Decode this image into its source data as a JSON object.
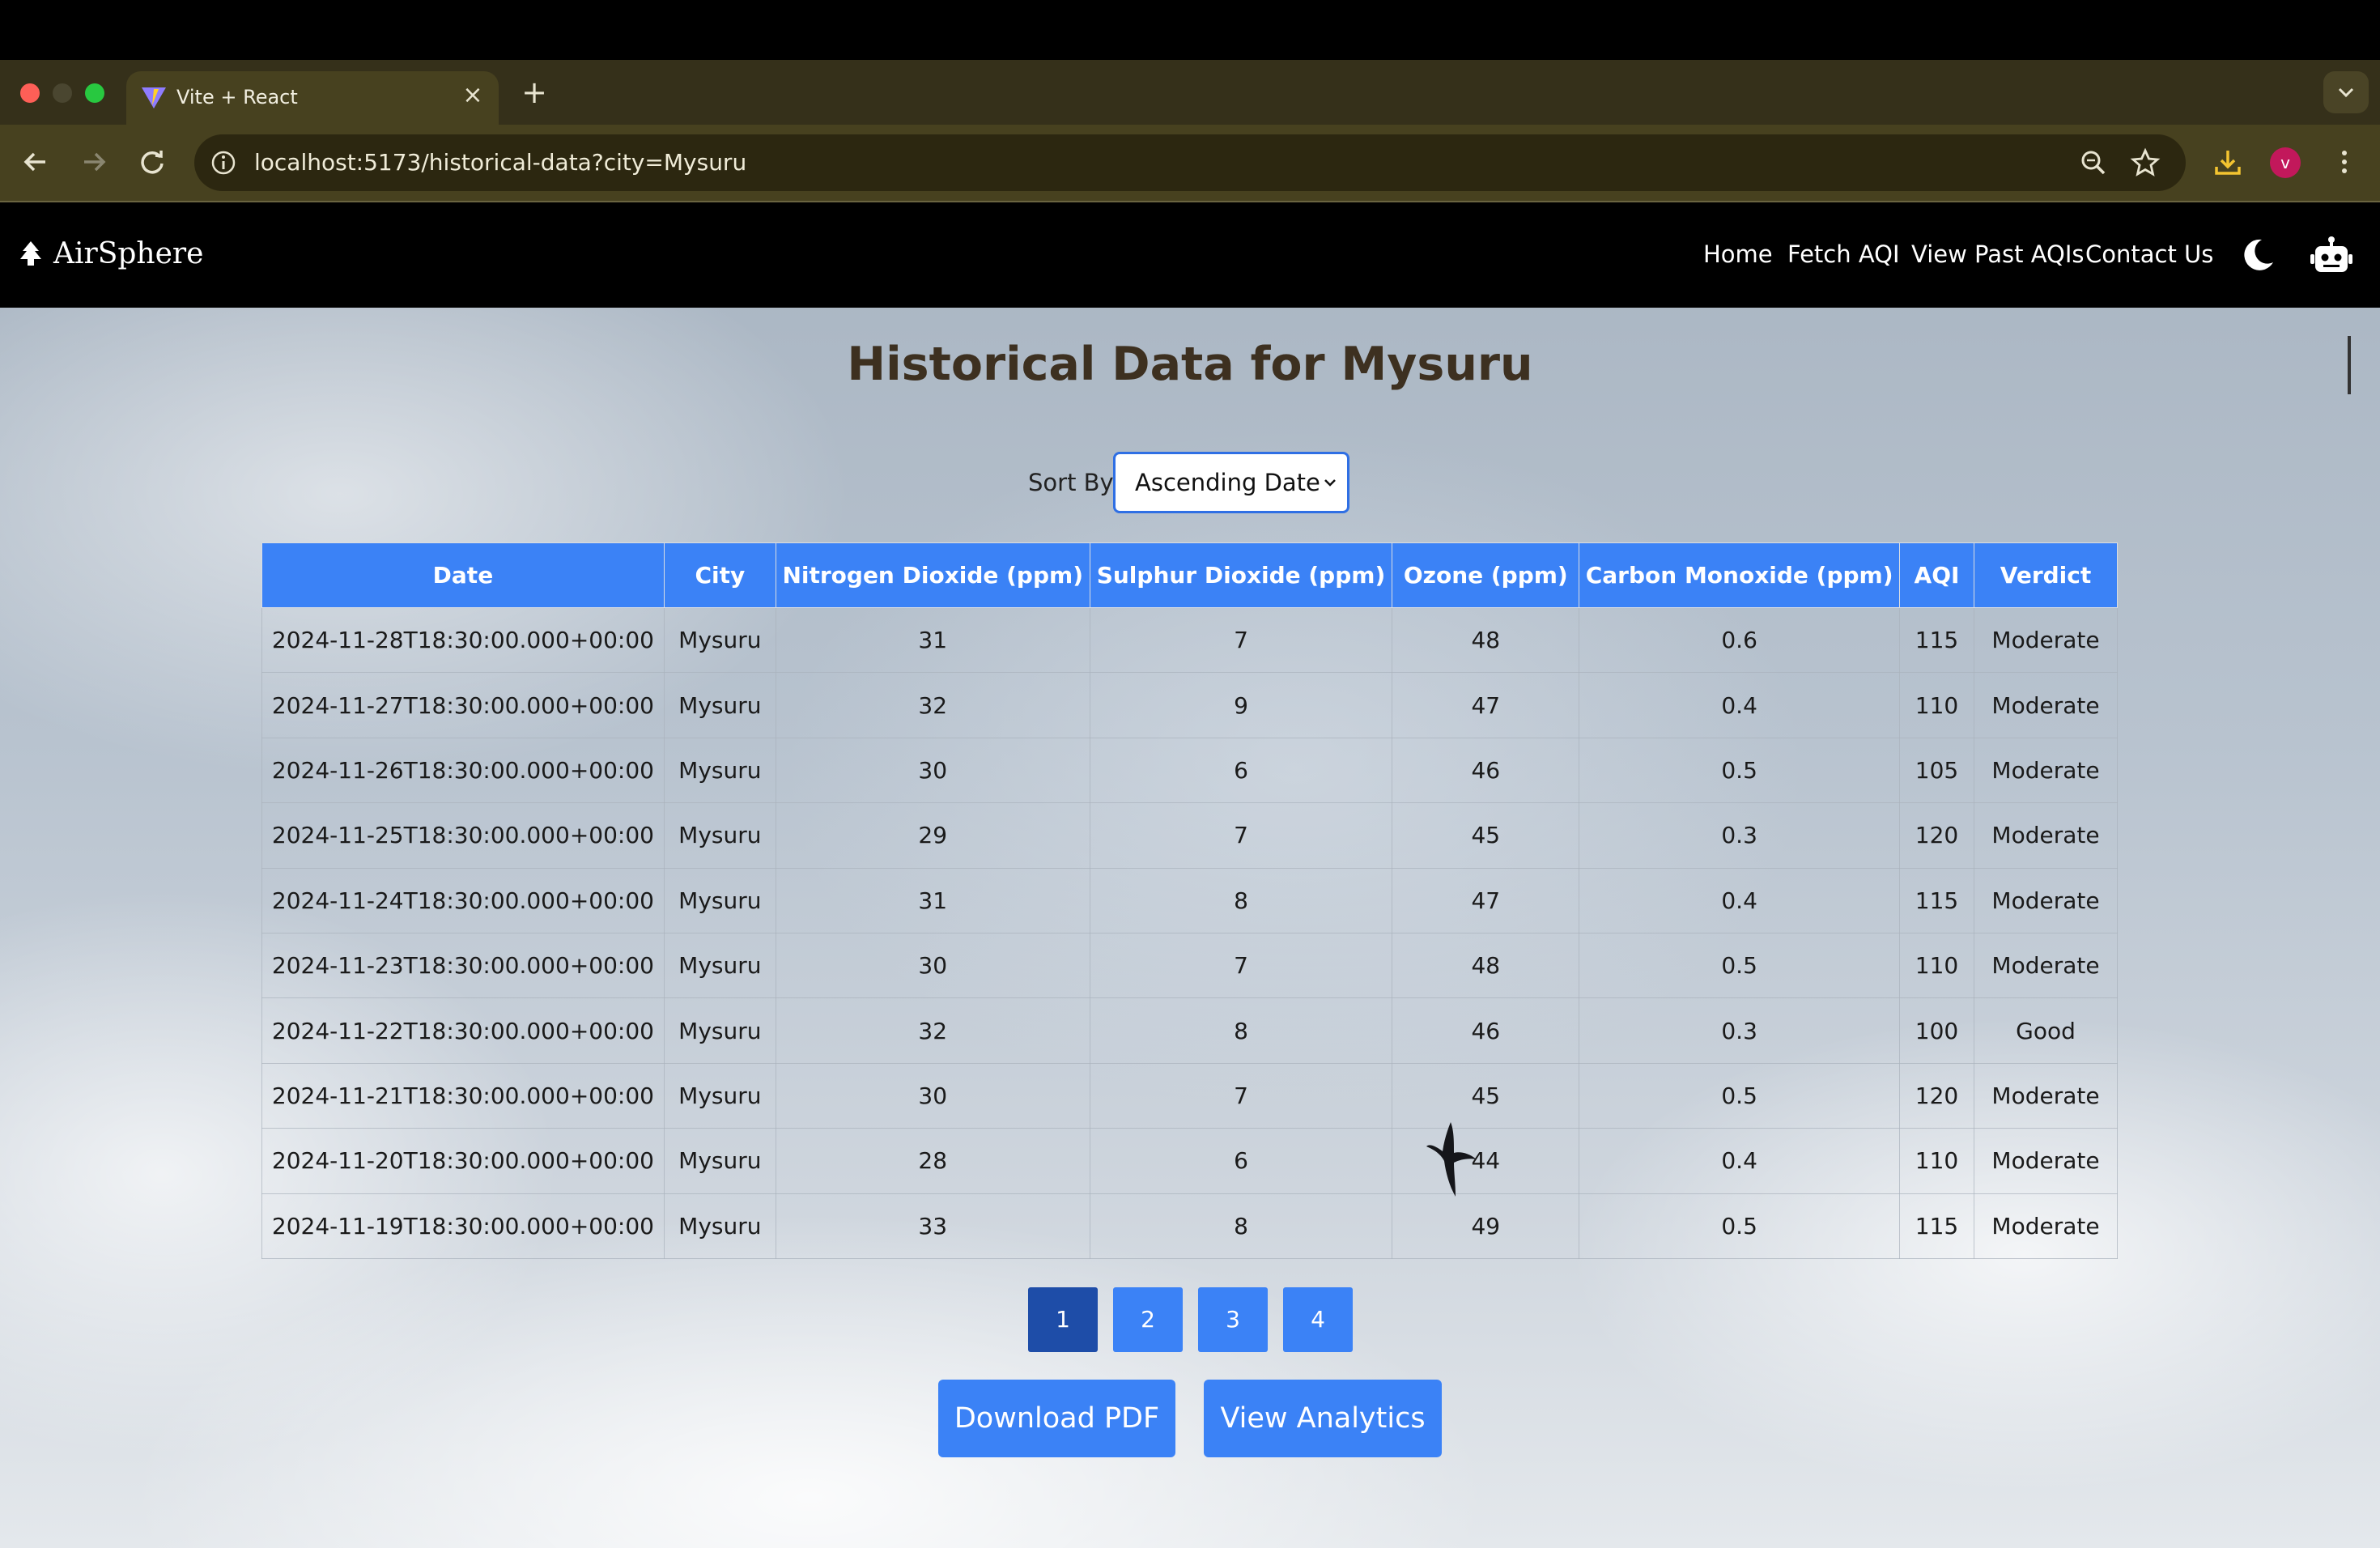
{
  "browser": {
    "tab_title": "Vite + React",
    "url": "localhost:5173/historical-data?city=Mysuru",
    "profile_initial": "v"
  },
  "appnav": {
    "brand": "AirSphere",
    "links": [
      "Home",
      "Fetch AQI",
      "View Past AQIs",
      "Contact Us"
    ]
  },
  "page": {
    "title": "Historical Data for Mysuru",
    "sort_label": "Sort By:",
    "sort_value": "Ascending Date"
  },
  "table": {
    "headers": [
      "Date",
      "City",
      "Nitrogen Dioxide (ppm)",
      "Sulphur Dioxide (ppm)",
      "Ozone (ppm)",
      "Carbon Monoxide (ppm)",
      "AQI",
      "Verdict"
    ],
    "rows": [
      [
        "2024-11-28T18:30:00.000+00:00",
        "Mysuru",
        "31",
        "7",
        "48",
        "0.6",
        "115",
        "Moderate"
      ],
      [
        "2024-11-27T18:30:00.000+00:00",
        "Mysuru",
        "32",
        "9",
        "47",
        "0.4",
        "110",
        "Moderate"
      ],
      [
        "2024-11-26T18:30:00.000+00:00",
        "Mysuru",
        "30",
        "6",
        "46",
        "0.5",
        "105",
        "Moderate"
      ],
      [
        "2024-11-25T18:30:00.000+00:00",
        "Mysuru",
        "29",
        "7",
        "45",
        "0.3",
        "120",
        "Moderate"
      ],
      [
        "2024-11-24T18:30:00.000+00:00",
        "Mysuru",
        "31",
        "8",
        "47",
        "0.4",
        "115",
        "Moderate"
      ],
      [
        "2024-11-23T18:30:00.000+00:00",
        "Mysuru",
        "30",
        "7",
        "48",
        "0.5",
        "110",
        "Moderate"
      ],
      [
        "2024-11-22T18:30:00.000+00:00",
        "Mysuru",
        "32",
        "8",
        "46",
        "0.3",
        "100",
        "Good"
      ],
      [
        "2024-11-21T18:30:00.000+00:00",
        "Mysuru",
        "30",
        "7",
        "45",
        "0.5",
        "120",
        "Moderate"
      ],
      [
        "2024-11-20T18:30:00.000+00:00",
        "Mysuru",
        "28",
        "6",
        "44",
        "0.4",
        "110",
        "Moderate"
      ],
      [
        "2024-11-19T18:30:00.000+00:00",
        "Mysuru",
        "33",
        "8",
        "49",
        "0.5",
        "115",
        "Moderate"
      ]
    ]
  },
  "pagination": {
    "pages": [
      "1",
      "2",
      "3",
      "4"
    ],
    "current": "1"
  },
  "actions": {
    "download_pdf": "Download PDF",
    "view_analytics": "View Analytics"
  },
  "colors": {
    "accent": "#3b82f6",
    "accent_active": "#1e4da8",
    "title": "#3d3020",
    "nav_bg": "#000000",
    "browser_toolbar": "#47411f"
  }
}
